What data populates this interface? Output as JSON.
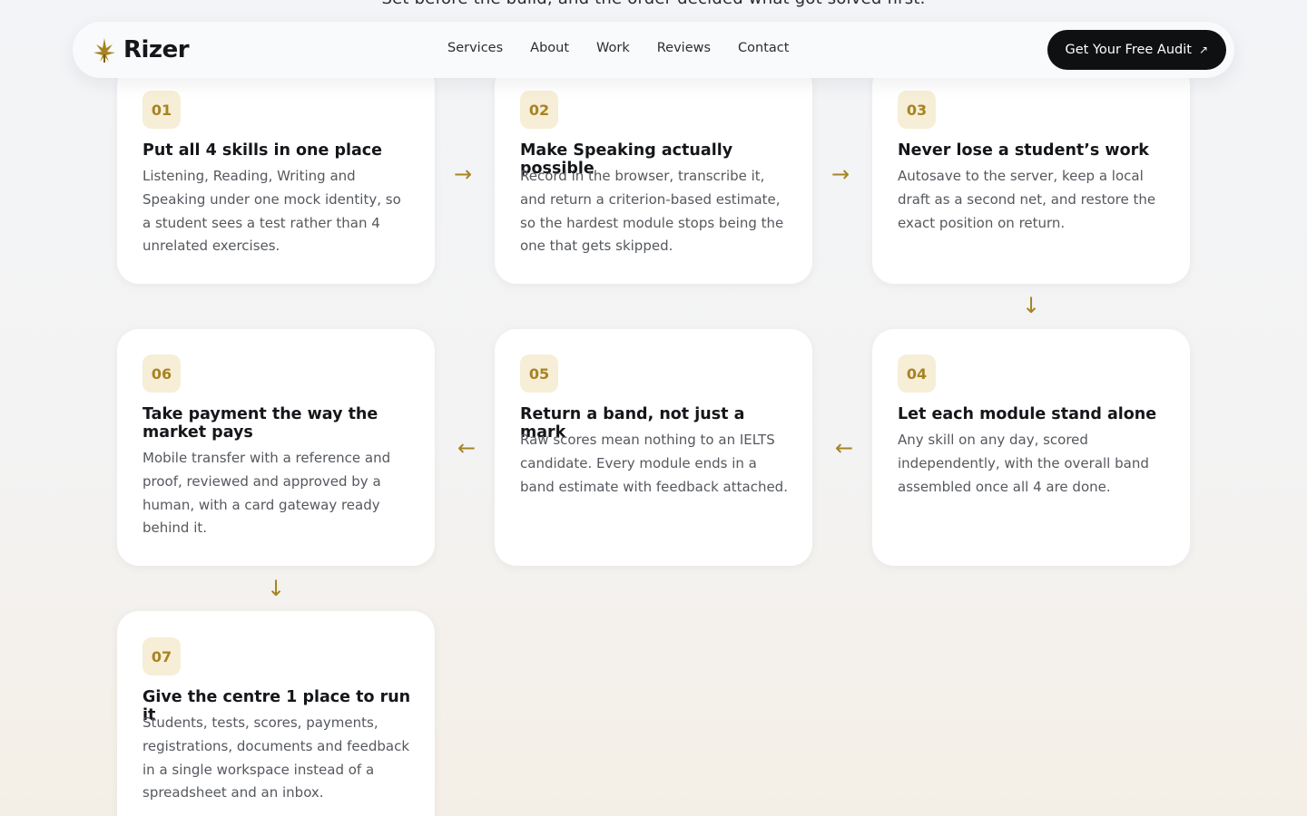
{
  "intro_fragment": "Set before the build, and the order decided what got solved first.",
  "navbar": {
    "brand": "Rizer",
    "links": [
      "Services",
      "About",
      "Work",
      "Reviews",
      "Contact"
    ],
    "cta_label": "Get Your Free Audit",
    "cta_icon": "↗"
  },
  "colors": {
    "accent": "#a78324",
    "badge_bg": "#f6eed6",
    "cta_bg": "#0f1012"
  },
  "steps": [
    {
      "number": "01",
      "title": "Put all 4 skills in one place",
      "body": "Listening, Reading, Writing and Speaking under one mock identity, so a student sees a test rather than 4 unrelated exercises."
    },
    {
      "number": "02",
      "title": "Make Speaking actually possible",
      "body": "Record in the browser, transcribe it, and return a criterion-based estimate, so the hardest module stops being the one that gets skipped."
    },
    {
      "number": "03",
      "title": "Never lose a student’s work",
      "body": "Autosave to the server, keep a local draft as a second net, and restore the exact position on return."
    },
    {
      "number": "04",
      "title": "Let each module stand alone",
      "body": "Any skill on any day, scored independently, with the overall band assembled once all 4 are done."
    },
    {
      "number": "05",
      "title": "Return a band, not just a mark",
      "body": "Raw scores mean nothing to an IELTS candidate. Every module ends in a band estimate with feedback attached."
    },
    {
      "number": "06",
      "title": "Take payment the way the market pays",
      "body": "Mobile transfer with a reference and proof, reviewed and approved by a human, with a card gateway ready behind it."
    },
    {
      "number": "07",
      "title": "Give the centre 1 place to run it",
      "body": "Students, tests, scores, payments, registrations, documents and feedback in a single workspace instead of a spreadsheet and an inbox."
    }
  ],
  "icons": {
    "logo": "leaf-logo-icon",
    "arrow_right": "→",
    "arrow_left": "←",
    "arrow_down": "↓"
  }
}
